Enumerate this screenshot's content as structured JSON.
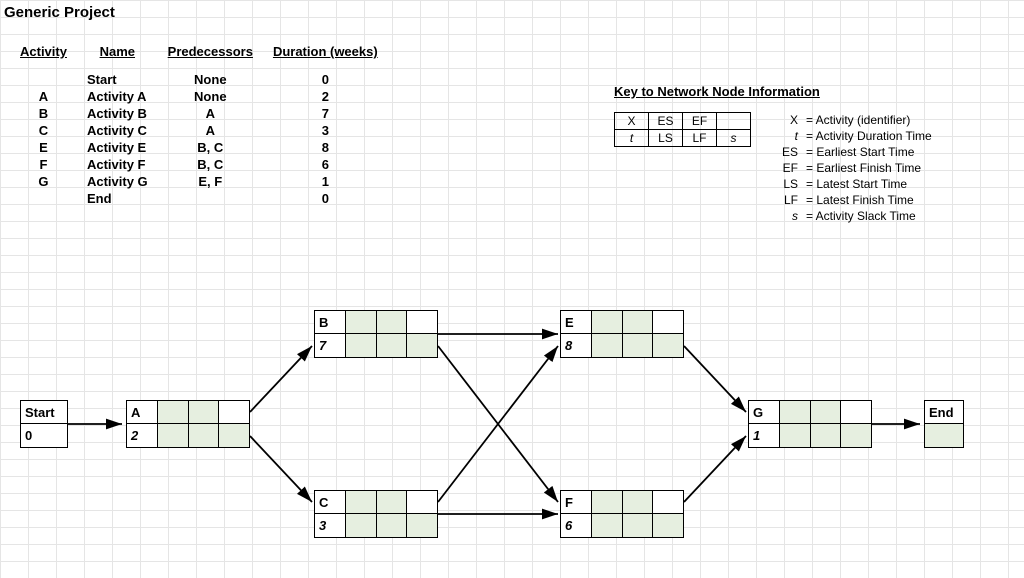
{
  "title": "Generic Project",
  "columns": {
    "activity": "Activity",
    "name": "Name",
    "predecessors": "Predecessors",
    "duration": "Duration (weeks)"
  },
  "activities": [
    {
      "id": "",
      "name": "Start",
      "pred": "None",
      "dur": "0"
    },
    {
      "id": "A",
      "name": "Activity A",
      "pred": "None",
      "dur": "2"
    },
    {
      "id": "B",
      "name": "Activity B",
      "pred": "A",
      "dur": "7"
    },
    {
      "id": "C",
      "name": "Activity C",
      "pred": "A",
      "dur": "3"
    },
    {
      "id": "E",
      "name": "Activity E",
      "pred": "B, C",
      "dur": "8"
    },
    {
      "id": "F",
      "name": "Activity F",
      "pred": "B, C",
      "dur": "6"
    },
    {
      "id": "G",
      "name": "Activity G",
      "pred": "E, F",
      "dur": "1"
    },
    {
      "id": "",
      "name": "End",
      "pred": "",
      "dur": "0"
    }
  ],
  "key": {
    "title": "Key to Network Node Information",
    "box": {
      "r1": {
        "c1": "X",
        "c2": "ES",
        "c3": "EF",
        "c4": ""
      },
      "r2": {
        "c1": "t",
        "c2": "LS",
        "c3": "LF",
        "c4": "s"
      }
    },
    "glossary": [
      {
        "sym": "X",
        "symItalic": false,
        "desc": "= Activity (identifier)"
      },
      {
        "sym": "t",
        "symItalic": true,
        "desc": "= Activity Duration Time"
      },
      {
        "sym": "ES",
        "symItalic": false,
        "desc": "= Earliest Start Time"
      },
      {
        "sym": "EF",
        "symItalic": false,
        "desc": "= Earliest Finish Time"
      },
      {
        "sym": "LS",
        "symItalic": false,
        "desc": "= Latest Start Time"
      },
      {
        "sym": "LF",
        "symItalic": false,
        "desc": "= Latest Finish Time"
      },
      {
        "sym": "s",
        "symItalic": true,
        "desc": "= Activity Slack Time"
      }
    ]
  },
  "nodes": {
    "start": {
      "label": "Start",
      "val": "0"
    },
    "A": {
      "id": "A",
      "dur": "2"
    },
    "B": {
      "id": "B",
      "dur": "7"
    },
    "C": {
      "id": "C",
      "dur": "3"
    },
    "E": {
      "id": "E",
      "dur": "8"
    },
    "F": {
      "id": "F",
      "dur": "6"
    },
    "G": {
      "id": "G",
      "dur": "1"
    },
    "end": {
      "label": "End"
    }
  },
  "chart_data": {
    "type": "table",
    "title": "Activity-on-Node project network",
    "nodes": [
      {
        "id": "Start",
        "duration": 0,
        "predecessors": []
      },
      {
        "id": "A",
        "duration": 2,
        "predecessors": [
          "Start"
        ]
      },
      {
        "id": "B",
        "duration": 7,
        "predecessors": [
          "A"
        ]
      },
      {
        "id": "C",
        "duration": 3,
        "predecessors": [
          "A"
        ]
      },
      {
        "id": "E",
        "duration": 8,
        "predecessors": [
          "B",
          "C"
        ]
      },
      {
        "id": "F",
        "duration": 6,
        "predecessors": [
          "B",
          "C"
        ]
      },
      {
        "id": "G",
        "duration": 1,
        "predecessors": [
          "E",
          "F"
        ]
      },
      {
        "id": "End",
        "duration": 0,
        "predecessors": [
          "G"
        ]
      }
    ],
    "edges": [
      [
        "Start",
        "A"
      ],
      [
        "A",
        "B"
      ],
      [
        "A",
        "C"
      ],
      [
        "B",
        "E"
      ],
      [
        "B",
        "F"
      ],
      [
        "C",
        "E"
      ],
      [
        "C",
        "F"
      ],
      [
        "E",
        "G"
      ],
      [
        "F",
        "G"
      ],
      [
        "G",
        "End"
      ]
    ]
  }
}
